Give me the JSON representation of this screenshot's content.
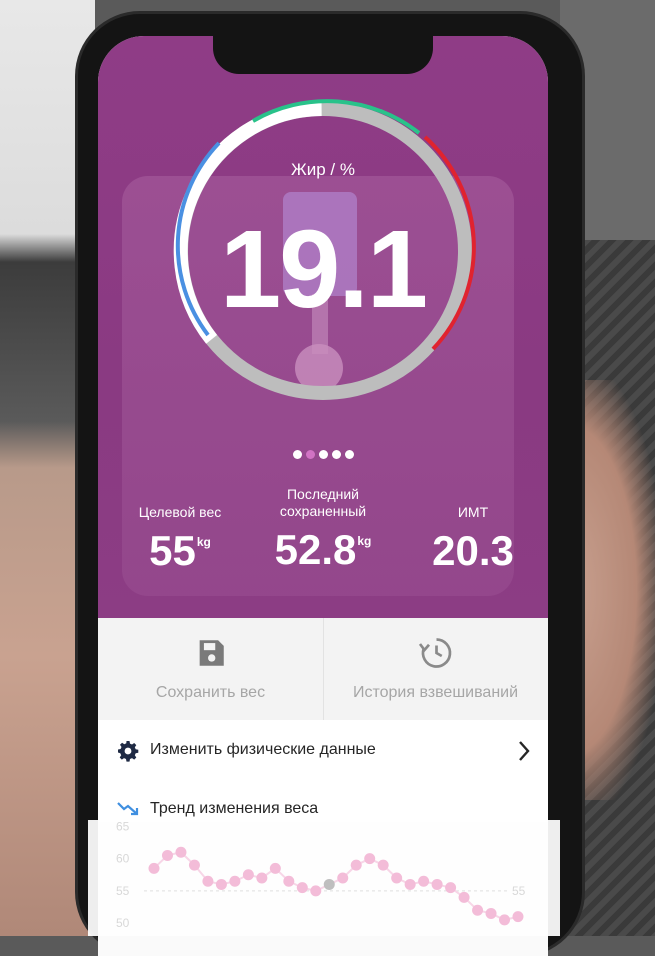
{
  "hero": {
    "metric_label": "Жир / %",
    "metric_value": "19.1",
    "pager": {
      "count": 5,
      "active_index": 1
    }
  },
  "stats": {
    "target": {
      "label": "Целевой вес",
      "value": "55",
      "unit": "kg"
    },
    "last": {
      "label_line1": "Последний",
      "label_line2": "сохраненный",
      "value": "52.8",
      "unit": "kg"
    },
    "bmi": {
      "label": "ИМТ",
      "value": "20.3"
    }
  },
  "actions": {
    "save": {
      "label": "Сохранить вес",
      "icon": "save-icon"
    },
    "history": {
      "label": "История взвешиваний",
      "icon": "history-icon"
    }
  },
  "menu": {
    "edit_physical": {
      "label": "Изменить физические данные",
      "icon": "gear-icon"
    },
    "trend": {
      "label": "Тренд изменения веса",
      "icon": "trend-icon"
    }
  },
  "colors": {
    "hero_bg": "#8c3b84",
    "ring_gray": "#bdbdbd",
    "ring_blue": "#4a90e2",
    "ring_green": "#29c28a",
    "ring_red": "#e0232f",
    "trend_point": "#f3b8d6",
    "accent_blue": "#3f8fe0"
  },
  "chart_data": {
    "type": "line",
    "y_ticks": [
      "65",
      "60",
      "55",
      "50"
    ],
    "reference_label": "55",
    "values": [
      58.5,
      60.5,
      61,
      59,
      56.5,
      56,
      56.5,
      57.5,
      57,
      58.5,
      56.5,
      55.5,
      55,
      56,
      57,
      59,
      60,
      59,
      57,
      56,
      56.5,
      56,
      55.5,
      54,
      52,
      51.5,
      50.5,
      51
    ]
  }
}
